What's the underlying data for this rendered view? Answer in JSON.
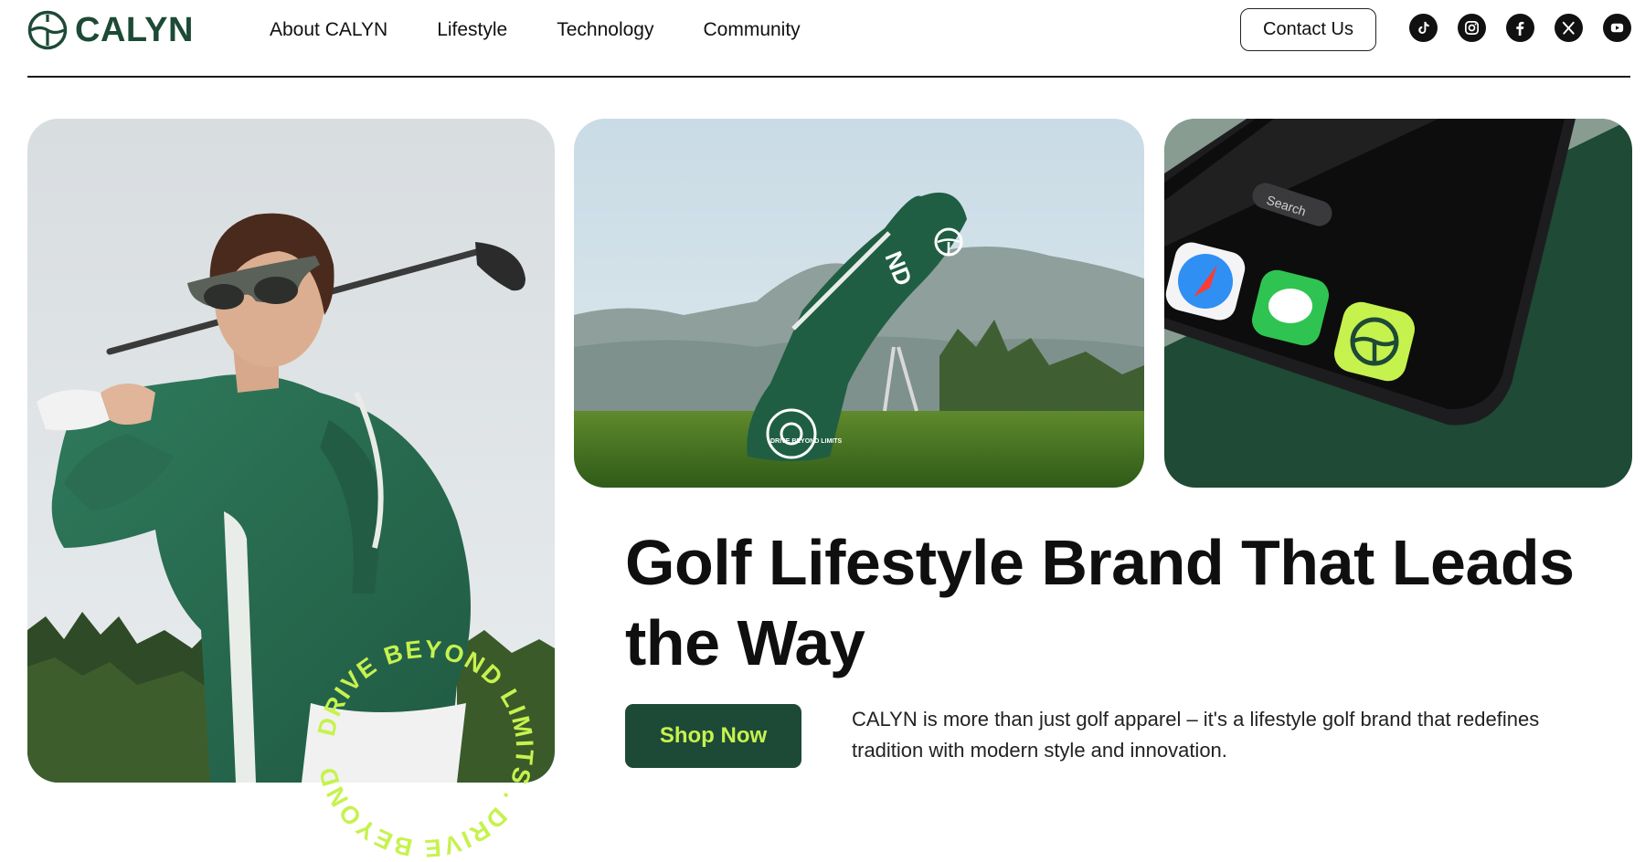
{
  "brand": {
    "name": "CALYN"
  },
  "nav": {
    "items": [
      {
        "label": "About CALYN"
      },
      {
        "label": "Lifestyle"
      },
      {
        "label": "Technology"
      },
      {
        "label": "Community"
      }
    ]
  },
  "header": {
    "contact_label": "Contact Us",
    "socials": [
      "tiktok-icon",
      "instagram-icon",
      "facebook-icon",
      "x-icon",
      "youtube-icon"
    ]
  },
  "hero": {
    "headline": "Golf Lifestyle Brand That Leads the Way",
    "cta_label": "Shop Now",
    "description": "CALYN is more than just golf apparel – it's a lifestyle golf brand that redefines tradition with modern style and innovation.",
    "ring_text": "DRIVE BEYOND LIMITS . DRIVE BEYOND LIMITS . ",
    "bag_text": "DRIVE BEYOND LIMITS",
    "phone_search": "Search"
  },
  "colors": {
    "brand_green": "#1d4a36",
    "accent_lime": "#c6f24e",
    "text_dark": "#0f0f0f"
  }
}
